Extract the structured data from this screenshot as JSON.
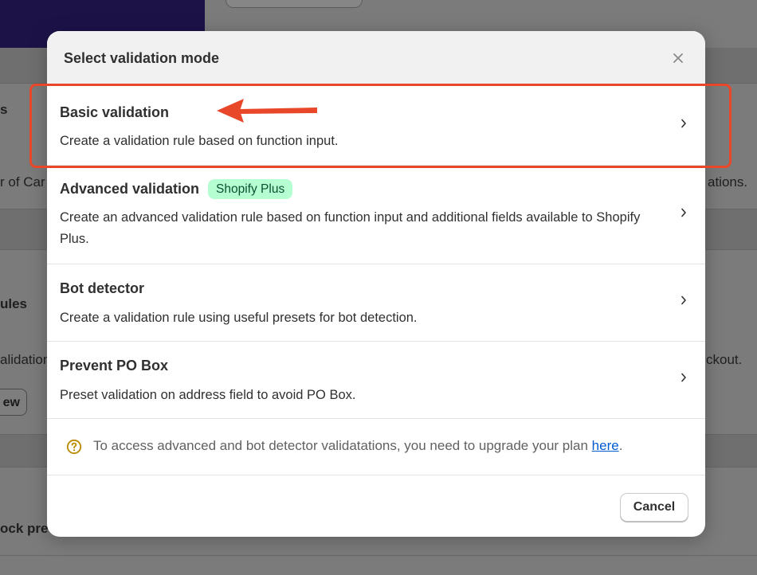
{
  "background": {
    "row1_fragment": "s",
    "row2_left_fragment": "r of Car",
    "row2_right_fragment": "ations.",
    "row3_fragment": "ules",
    "row4_left_fragment": "alidation",
    "row4_right_fragment": "ckout.",
    "view_button_fragment": "ew",
    "row5_fragment": "ock pre"
  },
  "modal": {
    "title": "Select validation mode",
    "close_icon": "close-icon",
    "options": [
      {
        "title": "Basic validation",
        "description": "Create a validation rule based on function input."
      },
      {
        "title": "Advanced validation",
        "badge": "Shopify Plus",
        "description": "Create an advanced validation rule based on function input and additional fields available to Shopify Plus."
      },
      {
        "title": "Bot detector",
        "description": "Create a validation rule using useful presets for bot detection."
      },
      {
        "title": "Prevent PO Box",
        "description": "Preset validation on address field to avoid PO Box."
      }
    ],
    "info": {
      "icon": "help-circle-icon",
      "text": "To access advanced and bot detector validatations, you need to upgrade your plan ",
      "link": "here",
      "suffix": "."
    },
    "footer": {
      "cancel_label": "Cancel"
    }
  },
  "annotation": {
    "highlight_color": "#e8472a"
  },
  "colors": {
    "badge_bg": "#b4fed2",
    "badge_text": "#0c5132",
    "link": "#005bd3",
    "help_icon": "#b98900"
  }
}
